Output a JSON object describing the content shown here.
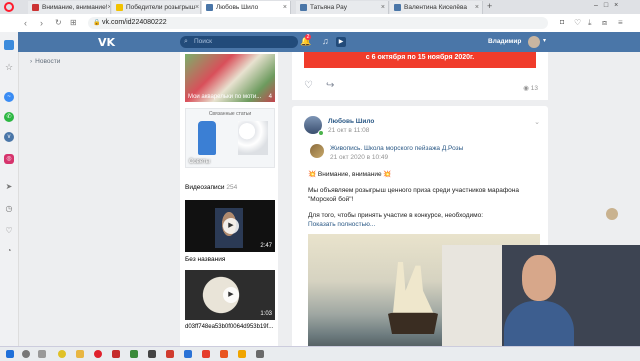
{
  "tabs": [
    {
      "title": "Внимание, внимание!",
      "color": "#cc3333"
    },
    {
      "title": "Победители розыгрыш",
      "color": "#f2c200"
    },
    {
      "title": "Любовь Шило",
      "color": "#4a76a8"
    },
    {
      "title": "Татьяна Рау",
      "color": "#4a76a8"
    },
    {
      "title": "Валентина Киселёва",
      "color": "#4a76a8"
    }
  ],
  "address": {
    "url": "vk.com/id224080222"
  },
  "vk": {
    "search_placeholder": "Поиск",
    "notif_count": "2",
    "user_name": "Владимир"
  },
  "leftnav": {
    "news": "Новости"
  },
  "col1": {
    "card1_caption": "Мои акварельки по моти...",
    "card1_count": "4",
    "card2_title": "Связанные статьи",
    "card2_caption": "Советы",
    "videos_label": "Видеозаписи",
    "videos_count": "254",
    "video1_duration": "2:47",
    "video1_title": "Без названия",
    "video2_duration": "1:03",
    "video2_title": "d03ff748ea53b0f0064d953b19f..."
  },
  "topcard": {
    "banner": "с 6 октября по 15 ноября 2020г.",
    "views": "13"
  },
  "post": {
    "author": "Любовь Шило",
    "date": "21 окт в 11:08",
    "repost_author": "Живопись. Школа морского пейзажа Д.Розы",
    "repost_date": "21 окт 2020 в 10:49",
    "line1": "💥 Внимание, внимание 💥",
    "line2": "Мы объявляем розыгрыш ценного приза среди участников марафона \"Морской бой\"!",
    "line3": "Для того, чтобы принять участие в конкурсе, необходимо:",
    "show_more": "Показать полностью..."
  }
}
